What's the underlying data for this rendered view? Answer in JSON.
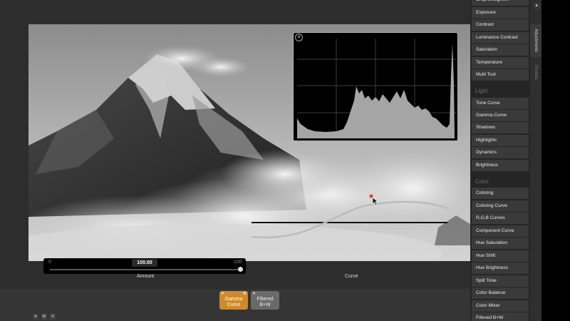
{
  "panel": {
    "top_items": [
      "Crop/Straighten",
      "Exposure",
      "Contrast",
      "Luminance Contrast",
      "Saturation",
      "Temperature",
      "Multi Tool"
    ],
    "light_heading": "Light",
    "light_items": [
      "Tone Curve",
      "Gamma Curve",
      "Shadows",
      "Highlights",
      "Dynamics",
      "Brightness"
    ],
    "color_heading": "Color",
    "color_items": [
      "Coloring",
      "Coloring Curve",
      "R,G,B Curves",
      "Component Curve",
      "Hue Saturation",
      "Hue Shift",
      "Hue Brightness",
      "Split Tone",
      "Color Balance",
      "Color Mixer",
      "Filtered B+W"
    ]
  },
  "tabs": {
    "adjustments": "Adjustments",
    "presets": "Presets"
  },
  "amount": {
    "label": "Amount",
    "value": "100.00",
    "min": "0",
    "max": "100",
    "level": 1.0
  },
  "curve": {
    "label": "Curve"
  },
  "tray": {
    "tiles": [
      "Gamma Curve",
      "Filtered B+W"
    ]
  },
  "icons": {
    "histogram_close": "close-icon",
    "tile_close": "close-icon",
    "tile_settings": "gear-icon",
    "panel_toggle": "chevron-right-icon",
    "tray_down": "chevron-down-icon",
    "tray_settings": "gear-icon",
    "tray_close": "close-icon"
  },
  "colors": {
    "accent": "#d08a2a",
    "panel": "#3a3a3a",
    "curve_handle": "#e04020"
  }
}
